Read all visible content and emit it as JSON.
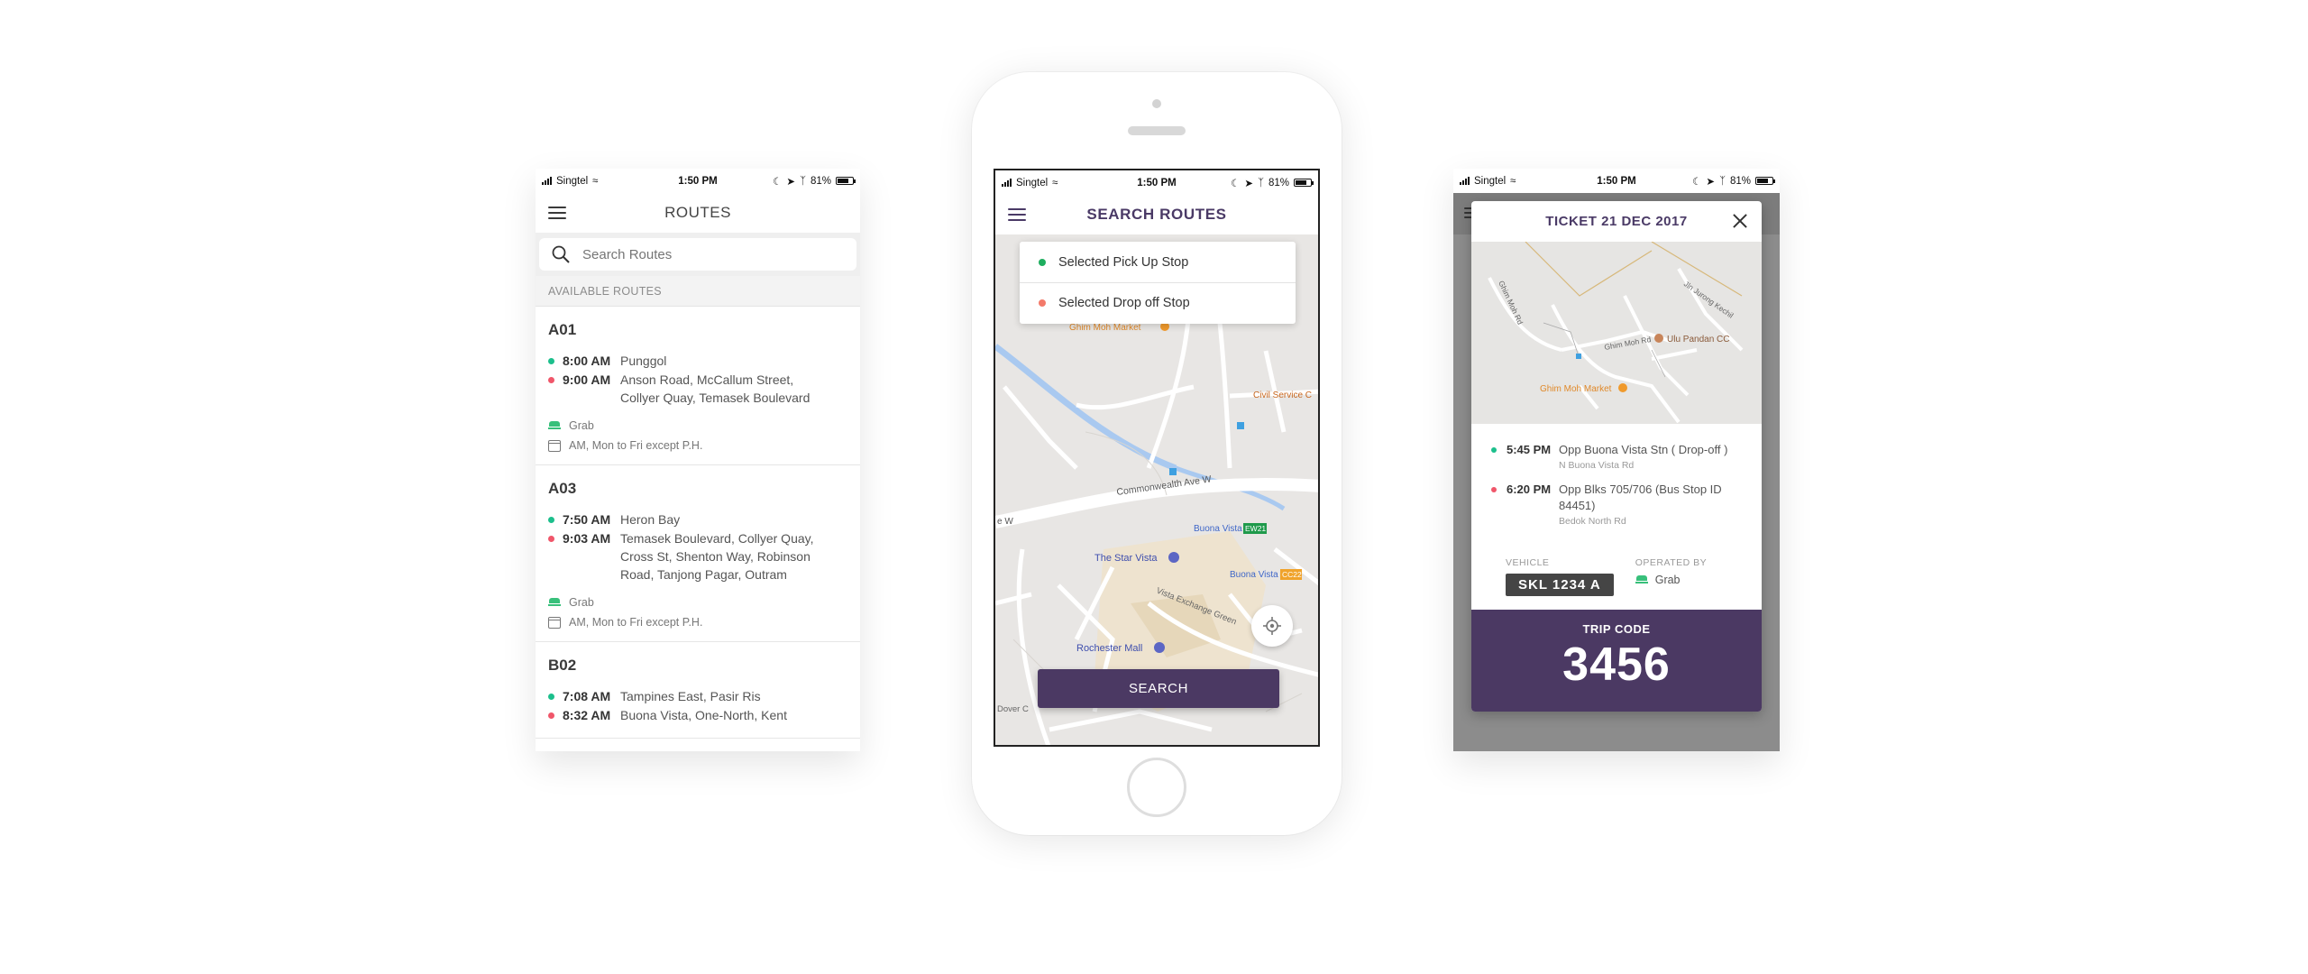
{
  "status_bar": {
    "carrier": "Singtel",
    "time": "1:50 PM",
    "battery": "81%"
  },
  "routes_screen": {
    "title": "ROUTES",
    "search_placeholder": "Search Routes",
    "section_label": "AVAILABLE ROUTES",
    "routes": [
      {
        "code": "A01",
        "stops": [
          {
            "time": "8:00 AM",
            "place": "Punggol",
            "type": "pickup"
          },
          {
            "time": "9:00 AM",
            "place": "Anson Road, McCallum Street, Collyer Quay, Temasek Boulevard",
            "type": "dropoff"
          }
        ],
        "operator": "Grab",
        "schedule": "AM, Mon to Fri except P.H."
      },
      {
        "code": "A03",
        "stops": [
          {
            "time": "7:50 AM",
            "place": "Heron Bay",
            "type": "pickup"
          },
          {
            "time": "9:03 AM",
            "place": "Temasek Boulevard, Collyer Quay, Cross St, Shenton Way, Robinson Road, Tanjong Pagar, Outram",
            "type": "dropoff"
          }
        ],
        "operator": "Grab",
        "schedule": "AM, Mon to Fri except P.H."
      },
      {
        "code": "B02",
        "stops": [
          {
            "time": "7:08 AM",
            "place": "Tampines East, Pasir Ris",
            "type": "pickup"
          },
          {
            "time": "8:32 AM",
            "place": "Buona Vista, One-North, Kent",
            "type": "dropoff"
          }
        ]
      }
    ]
  },
  "search_screen": {
    "title": "SEARCH ROUTES",
    "pickup_label": "Selected Pick Up Stop",
    "dropoff_label": "Selected Drop off Stop",
    "search_button": "SEARCH",
    "map_labels": {
      "ghim_moh": "Ghim Moh Market",
      "civil_service": "Civil Service C",
      "commonwealth": "Commonwealth Ave W",
      "ave_w": "e W",
      "buona_vista": "Buona Vista",
      "ew21": "EW21",
      "cc22": "CC22",
      "star_vista": "The Star Vista",
      "rochester": "Rochester Mall",
      "vista_exchange": "Vista Exchange Green",
      "dover": "Dover C"
    },
    "colors": {
      "accent": "#4b3963",
      "pickup": "#1fae5f",
      "dropoff": "#f37a6a"
    }
  },
  "ticket_screen": {
    "title": "TICKET 21 DEC 2017",
    "map_labels": {
      "ulu_pandan": "Ulu Pandan CC",
      "ghim_moh_market": "Ghim Moh Market",
      "ghim_moh_rd": "Ghim Moh Rd"
    },
    "stops": [
      {
        "time": "5:45 PM",
        "place": "Opp Buona Vista Stn ( Drop-off )",
        "sub": "N Buona Vista Rd",
        "type": "pickup"
      },
      {
        "time": "6:20 PM",
        "place": "Opp Blks 705/706 (Bus Stop ID 84451)",
        "sub": "Bedok North Rd",
        "type": "dropoff"
      }
    ],
    "vehicle_label": "VEHICLE",
    "vehicle_plate": "SKL 1234 A",
    "operated_by_label": "OPERATED BY",
    "operator": "Grab",
    "trip_code_label": "TRIP CODE",
    "trip_code": "3456"
  }
}
